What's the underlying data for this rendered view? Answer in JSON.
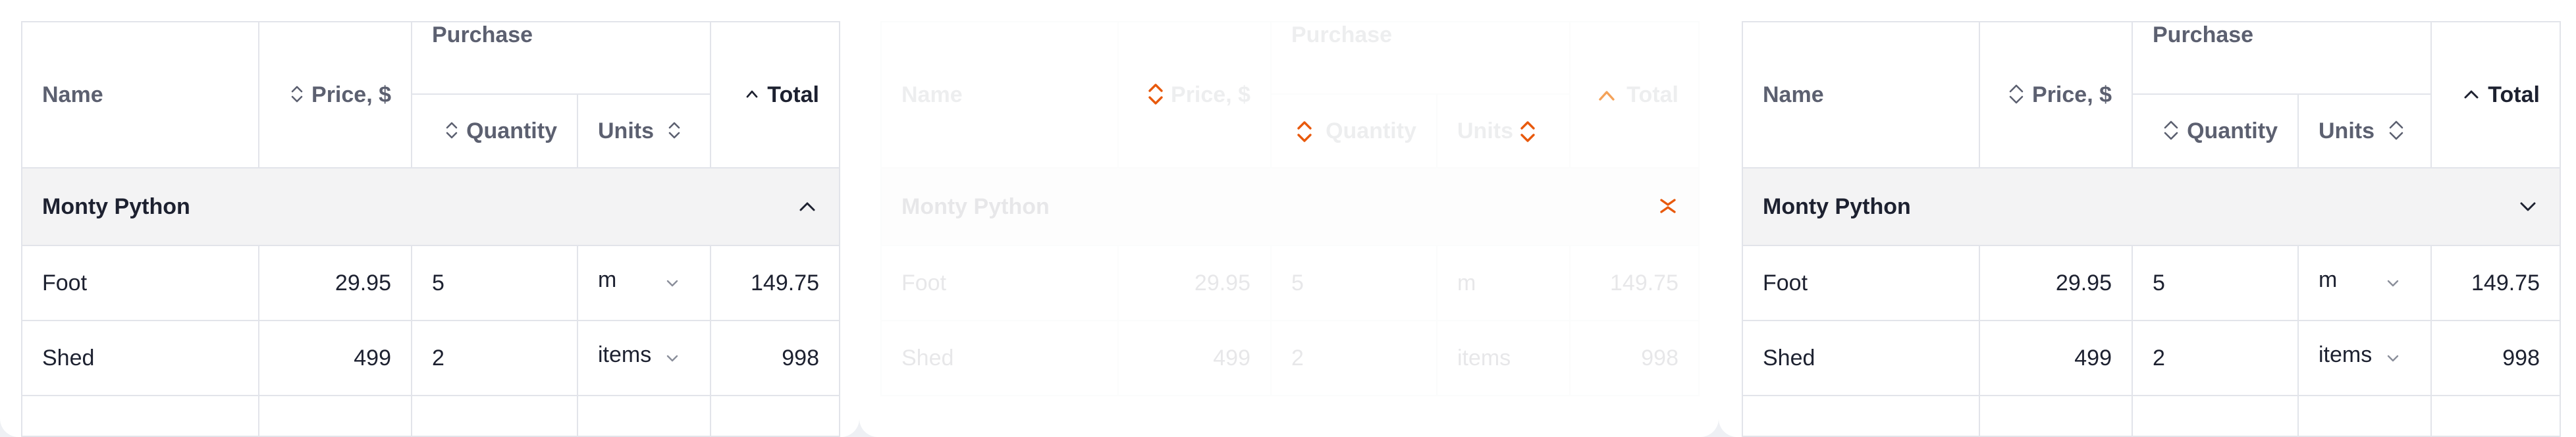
{
  "headers": {
    "name": "Name",
    "price": "Price, $",
    "purchase": "Purchase",
    "quantity": "Quantity",
    "units": "Units",
    "total": "Total"
  },
  "group": {
    "title": "Monty Python"
  },
  "rows": [
    {
      "name": "Foot",
      "price": "29.95",
      "quantity": "5",
      "units": "m",
      "total": "149.75"
    },
    {
      "name": "Shed",
      "price": "499",
      "quantity": "2",
      "units": "items",
      "total": "998"
    }
  ],
  "colors": {
    "sort_highlight": "#e8590c",
    "text": "#1d2130",
    "muted": "#5c6070",
    "group_bg": "#f3f3f4"
  }
}
